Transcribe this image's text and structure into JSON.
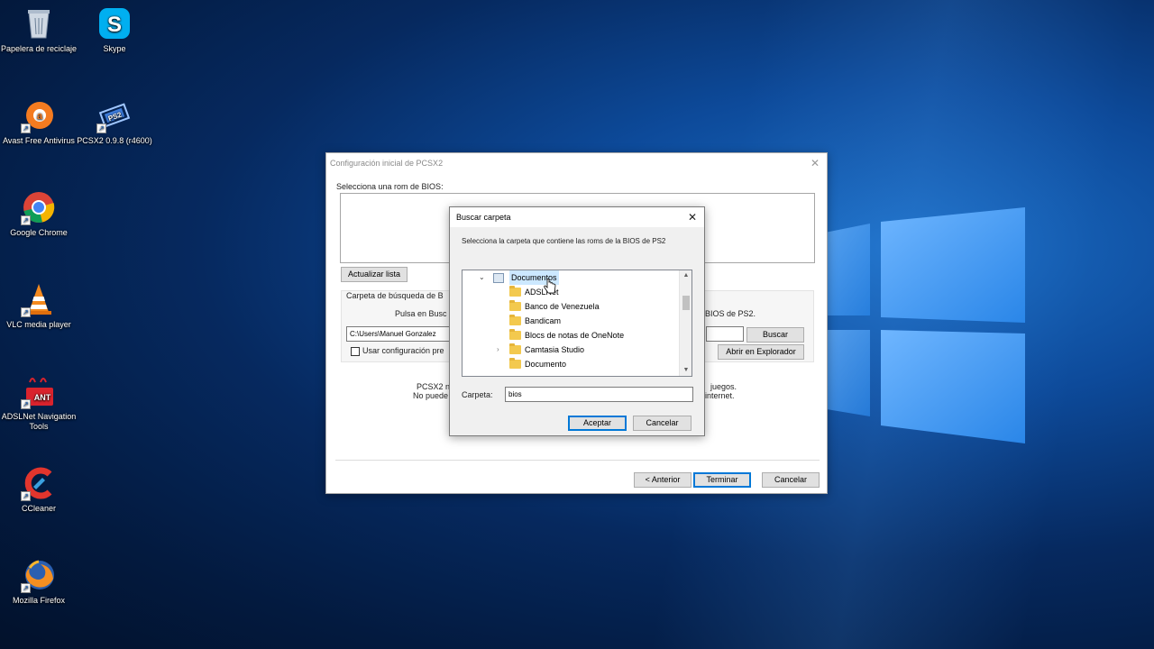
{
  "desktop": {
    "icons": [
      {
        "label": "Papelera de reciclaje",
        "icon": "recycle-bin-icon"
      },
      {
        "label": "Skype",
        "icon": "skype-icon"
      },
      {
        "label": "Avast Free Antivirus",
        "icon": "avast-icon"
      },
      {
        "label": "PCSX2 0.9.8 (r4600)",
        "icon": "pcsx2-icon"
      },
      {
        "label": "Google Chrome",
        "icon": "chrome-icon"
      },
      {
        "label": "VLC media player",
        "icon": "vlc-icon"
      },
      {
        "label": "ADSLNet Navigation Tools",
        "icon": "adslnet-icon"
      },
      {
        "label": "CCleaner",
        "icon": "ccleaner-icon"
      },
      {
        "label": "Mozilla Firefox",
        "icon": "firefox-icon"
      }
    ]
  },
  "pcsx2_window": {
    "title": "Configuración inicial de PCSX2",
    "bios_label": "Selecciona una rom de BIOS:",
    "refresh_button": "Actualizar lista",
    "search_folder_label": "Carpeta de búsqueda de B",
    "instructions_left": "Pulsa en Busc",
    "instructions_right": "BIOS de PS2.",
    "path_value": "C:\\Users\\Manuel Gonzalez",
    "browse_button": "Buscar",
    "use_default_checkbox": "Usar configuración pre",
    "open_explorer_button": "Abrir en Explorador",
    "note_line1_left": "PCSX2 n",
    "note_line1_right": "juegos.",
    "note_line2_left": "No puede",
    "note_line2_right": "internet.",
    "back_button": "< Anterior",
    "finish_button": "Terminar",
    "cancel_button": "Cancelar"
  },
  "browse_dialog": {
    "title": "Buscar carpeta",
    "instructions": "Selecciona la carpeta que contiene las roms de la BIOS de PS2",
    "tree": {
      "root": "Documentos",
      "items": [
        {
          "label": "ADSLNet",
          "expandable": false
        },
        {
          "label": "Banco de Venezuela",
          "expandable": false
        },
        {
          "label": "Bandicam",
          "expandable": false
        },
        {
          "label": "Blocs de notas de OneNote",
          "expandable": false
        },
        {
          "label": "Camtasia Studio",
          "expandable": true
        },
        {
          "label": "Documento",
          "expandable": false
        }
      ]
    },
    "folder_label": "Carpeta:",
    "folder_value": "bios",
    "accept_button": "Aceptar",
    "cancel_button": "Cancelar"
  }
}
